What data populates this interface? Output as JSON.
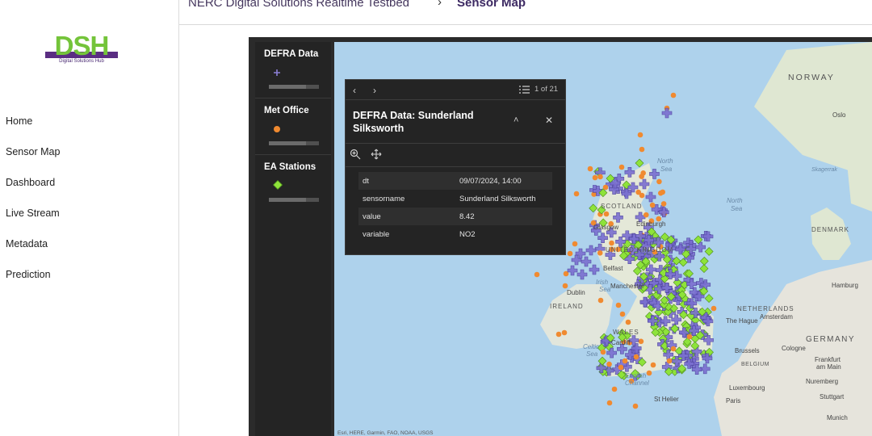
{
  "sidebar": {
    "logo_text": "DSH",
    "logo_subtext": "Digital Solutions Hub",
    "items": [
      {
        "label": "Home"
      },
      {
        "label": "Sensor Map"
      },
      {
        "label": "Dashboard"
      },
      {
        "label": "Live Stream"
      },
      {
        "label": "Metadata"
      },
      {
        "label": "Prediction"
      }
    ]
  },
  "header": {
    "breadcrumb_root": "NERC Digital Solutions Realtime Testbed",
    "breadcrumb_separator": "›",
    "breadcrumb_current": "Sensor Map"
  },
  "layers": [
    {
      "title": "DEFRA Data",
      "symbol": "plus-icon",
      "color": "#8b7fd6"
    },
    {
      "title": "Met Office",
      "symbol": "circle-icon",
      "color": "#f08a30"
    },
    {
      "title": "EA Stations",
      "symbol": "diamond-icon",
      "color": "#8ee33a"
    }
  ],
  "map_labels": {
    "norway": "NORWAY",
    "oslo": "Oslo",
    "skagerrak": "Skagerrak",
    "north_sea_1": "North",
    "north_sea_1b": "Sea",
    "north_sea_2": "North",
    "north_sea_2b": "Sea",
    "denmark": "DENMARK",
    "scotland": "SCOTLAND",
    "edinburgh": "Edinburgh",
    "glasgow": "Glasgow",
    "united_kingdom": "UNITED KINGDOM",
    "belfast": "Belfast",
    "irish_sea": "Irish",
    "irish_sea_b": "Sea",
    "dublin": "Dublin",
    "ireland": "IRELAND",
    "manchester": "Manchester",
    "wales": "WALES",
    "cardiff": "Cardiff",
    "celtic_sea": "Celtic",
    "celtic_sea_b": "Sea",
    "english_channel": "English",
    "english_channel_b": "Channel",
    "st_helier": "St Helier",
    "hamburg": "Hamburg",
    "netherlands": "NETHERLANDS",
    "the_hague": "The Hague",
    "amsterdam": "Amsterdam",
    "germany": "GERMANY",
    "brussels": "Brussels",
    "cologne": "Cologne",
    "belgium": "BELGIUM",
    "frankfurt": "Frankfurt",
    "frankfurt_b": "am Main",
    "luxembourg": "Luxembourg",
    "nuremberg": "Nuremberg",
    "stuttgart": "Stuttgart",
    "paris": "Paris",
    "munich": "Munich",
    "attribution": "Esri, HERE, Garmin, FAO, NOAA, USGS"
  },
  "popup": {
    "prev": "‹",
    "next": "›",
    "count": "1 of 21",
    "title": "DEFRA Data: Sunderland Silksworth",
    "collapse": "˄",
    "close": "✕",
    "rows": [
      {
        "key": "dt",
        "value": "09/07/2024, 14:00"
      },
      {
        "key": "sensorname",
        "value": "Sunderland Silksworth"
      },
      {
        "key": "value",
        "value": "8.42"
      },
      {
        "key": "variable",
        "value": "NO2"
      }
    ]
  }
}
